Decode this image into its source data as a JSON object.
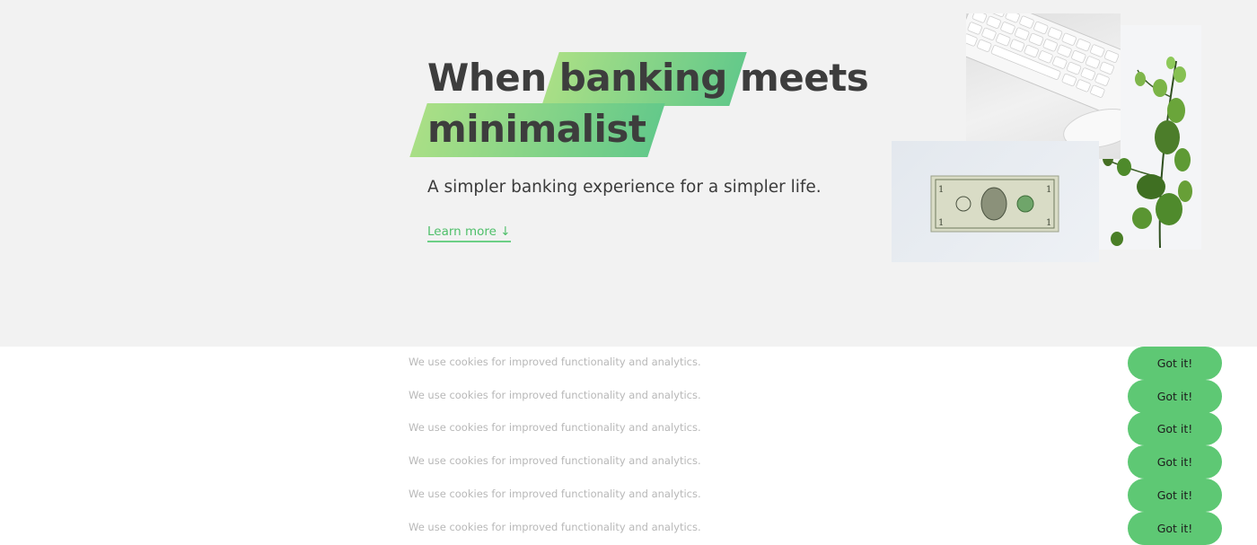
{
  "hero": {
    "headline_word_1": "When",
    "headline_highlight_1": "banking",
    "headline_word_2": "meets",
    "headline_highlight_2": "minimalist",
    "subtitle": "A simpler banking experience for a simpler life.",
    "learn_more_label": "Learn more",
    "learn_more_icon": "arrow-down-icon",
    "highlight_gradient": [
      "#a9df86",
      "#64c98a"
    ]
  },
  "collage": {
    "images": [
      "keyboard-mouse-photo",
      "plant-photo",
      "dollar-bill-photo"
    ]
  },
  "cookie_banners": [
    {
      "text": "We use cookies for improved functionality and analytics.",
      "button": "Got it!"
    },
    {
      "text": "We use cookies for improved functionality and analytics.",
      "button": "Got it!"
    },
    {
      "text": "We use cookies for improved functionality and analytics.",
      "button": "Got it!"
    },
    {
      "text": "We use cookies for improved functionality and analytics.",
      "button": "Got it!"
    },
    {
      "text": "We use cookies for improved functionality and analytics.",
      "button": "Got it!"
    },
    {
      "text": "We use cookies for improved functionality and analytics.",
      "button": "Got it!"
    }
  ],
  "colors": {
    "accent": "#5ec874",
    "link": "#4fbf6a",
    "hero_background": "#f2f2f2",
    "text": "#3d3d3d"
  }
}
